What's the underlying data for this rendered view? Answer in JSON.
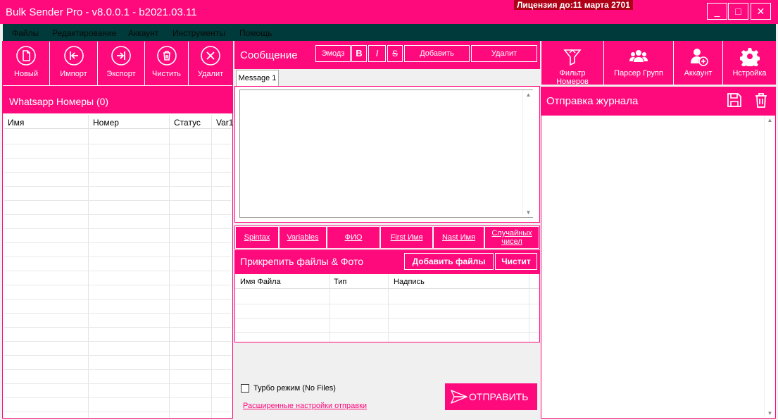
{
  "window": {
    "title": "Bulk Sender Pro - v8.0.0.1 - b2021.03.11",
    "license": "Лицензия до:11 марта 2701",
    "minimize": "_",
    "maximize": "□",
    "close": "✕"
  },
  "menu": [
    "Файлы",
    "Редактирование",
    "Аккаунт",
    "Инструменты",
    "Помощь"
  ],
  "left_toolbar": {
    "new": "Новый",
    "import": "Импорт",
    "export": "Экспорт",
    "clear": "Чистить",
    "delete": "Удалит"
  },
  "numbers_panel": {
    "title": "Whatsapp Номеры (0)",
    "columns": [
      "Имя",
      "Номер",
      "Статус",
      "Var1"
    ]
  },
  "message": {
    "title": "Сообщение",
    "emoji": "Эмодз",
    "bold": "B",
    "italic": "I",
    "strike": "S",
    "add": "Добавить",
    "remove": "Удалит",
    "tab": "Message 1",
    "text": ""
  },
  "links": [
    "Spintax",
    "Variables",
    "ФИО",
    "First Имя",
    "Nast Имя",
    "Случайных чисел"
  ],
  "attach": {
    "title": "Прикрепить файлы & Фото",
    "add_files": "Добавить файлы",
    "clear": "Чистит",
    "columns": [
      "Имя Файла",
      "Тип",
      "Надпись"
    ]
  },
  "bottom": {
    "turbo": "Турбо режим (No Files)",
    "advanced": "Расширенные настройки отправки",
    "send": "ОТПРАВИТЬ"
  },
  "right_toolbar": {
    "filter": "Фильтр Номеров",
    "parser": "Парсер Групп",
    "account": "Аккаунт",
    "settings": "Нстройка"
  },
  "log": {
    "title": "Отправка журнала"
  },
  "colors": {
    "accent": "#ff0a7d",
    "menubar": "#003a3a",
    "license_bg": "#b00018"
  }
}
